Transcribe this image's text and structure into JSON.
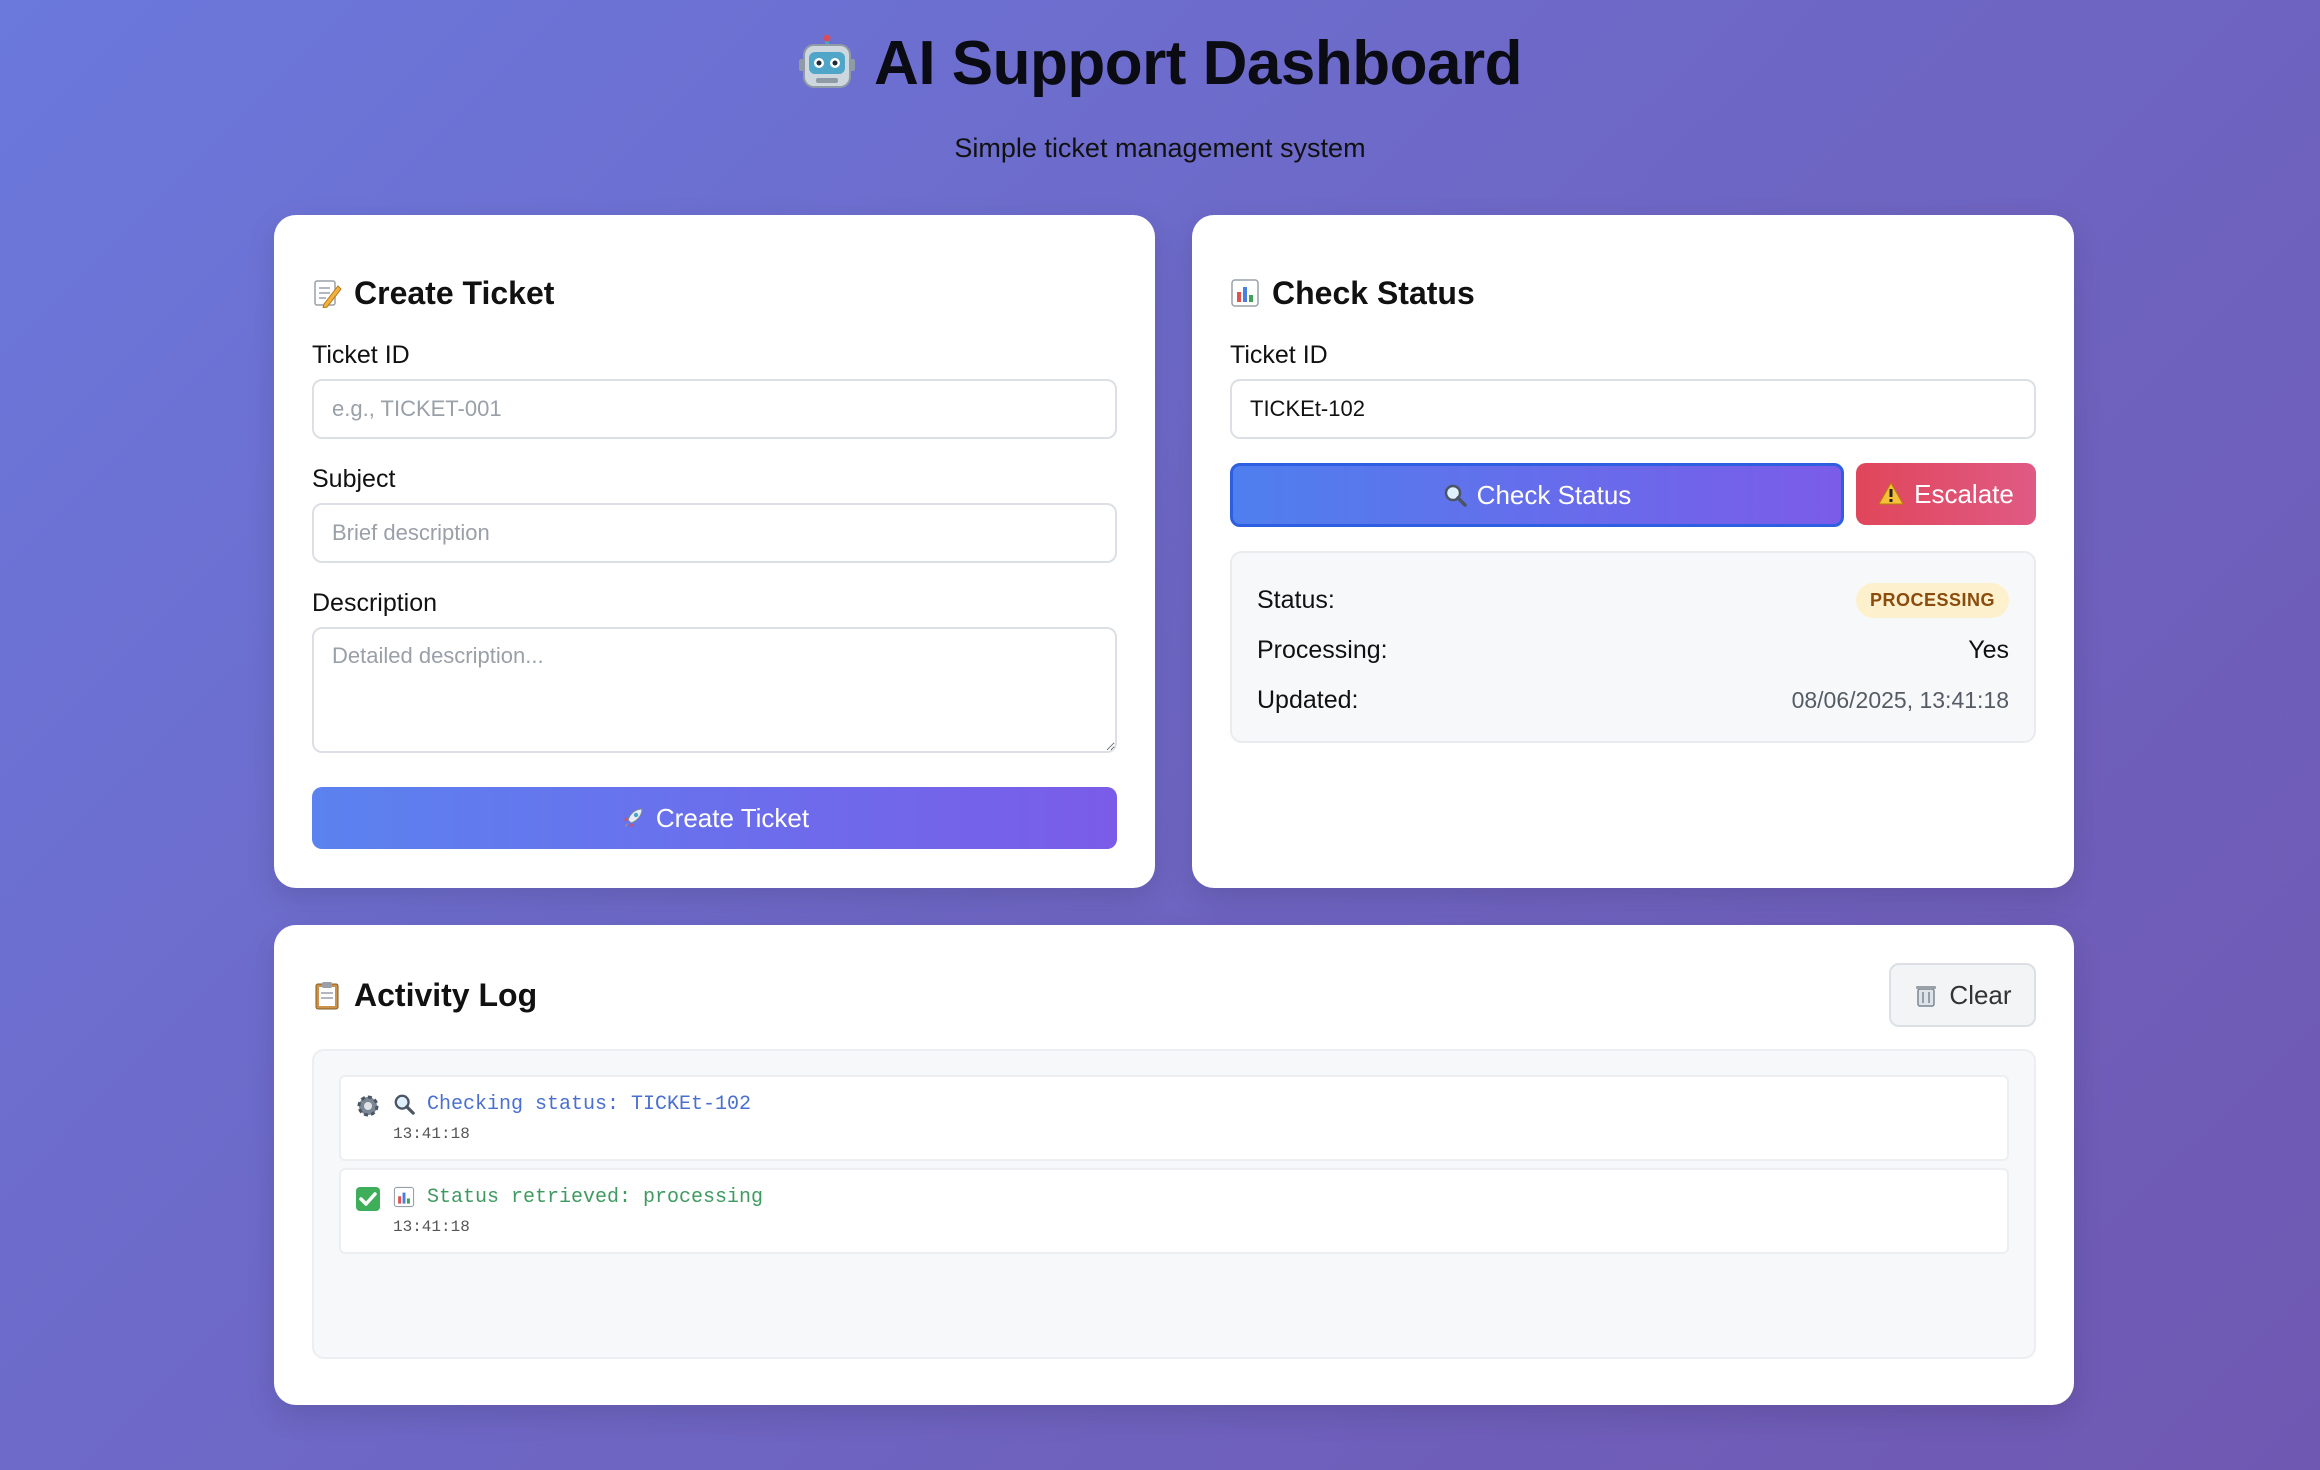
{
  "header": {
    "title": "AI Support Dashboard",
    "subtitle": "Simple ticket management system"
  },
  "create_ticket": {
    "title": "Create Ticket",
    "ticket_id_label": "Ticket ID",
    "ticket_id_value": "",
    "ticket_id_placeholder": "e.g., TICKET-001",
    "subject_label": "Subject",
    "subject_value": "",
    "subject_placeholder": "Brief description",
    "description_label": "Description",
    "description_value": "",
    "description_placeholder": "Detailed description...",
    "submit_label": "Create Ticket"
  },
  "check_status": {
    "title": "Check Status",
    "ticket_id_label": "Ticket ID",
    "ticket_id_value": "TICKEt-102",
    "check_label": "Check Status",
    "escalate_label": "Escalate",
    "result": {
      "status_label": "Status:",
      "status_value": "PROCESSING",
      "processing_label": "Processing:",
      "processing_value": "Yes",
      "updated_label": "Updated:",
      "updated_value": "08/06/2025, 13:41:18"
    }
  },
  "activity_log": {
    "title": "Activity Log",
    "clear_label": "Clear",
    "entries": [
      {
        "icon": "gear-icon",
        "type": "info",
        "message_icon": "magnifier-icon",
        "message": "Checking status: TICKEt-102",
        "time": "13:41:18"
      },
      {
        "icon": "check-icon",
        "type": "success",
        "message_icon": "chart-icon",
        "message": "Status retrieved: processing",
        "time": "13:41:18"
      }
    ]
  },
  "colors": {
    "background_start": "#6b78dc",
    "background_end": "#6f58b2",
    "primary_gradient_start": "#5b82ef",
    "primary_gradient_end": "#7a5ce9",
    "escalate_start": "#e0465a",
    "escalate_end": "#e05a84",
    "badge_bg": "#fdf0cc",
    "badge_text": "#8a4b0c",
    "log_info": "#4a6fd0",
    "log_success": "#3f9a62"
  }
}
